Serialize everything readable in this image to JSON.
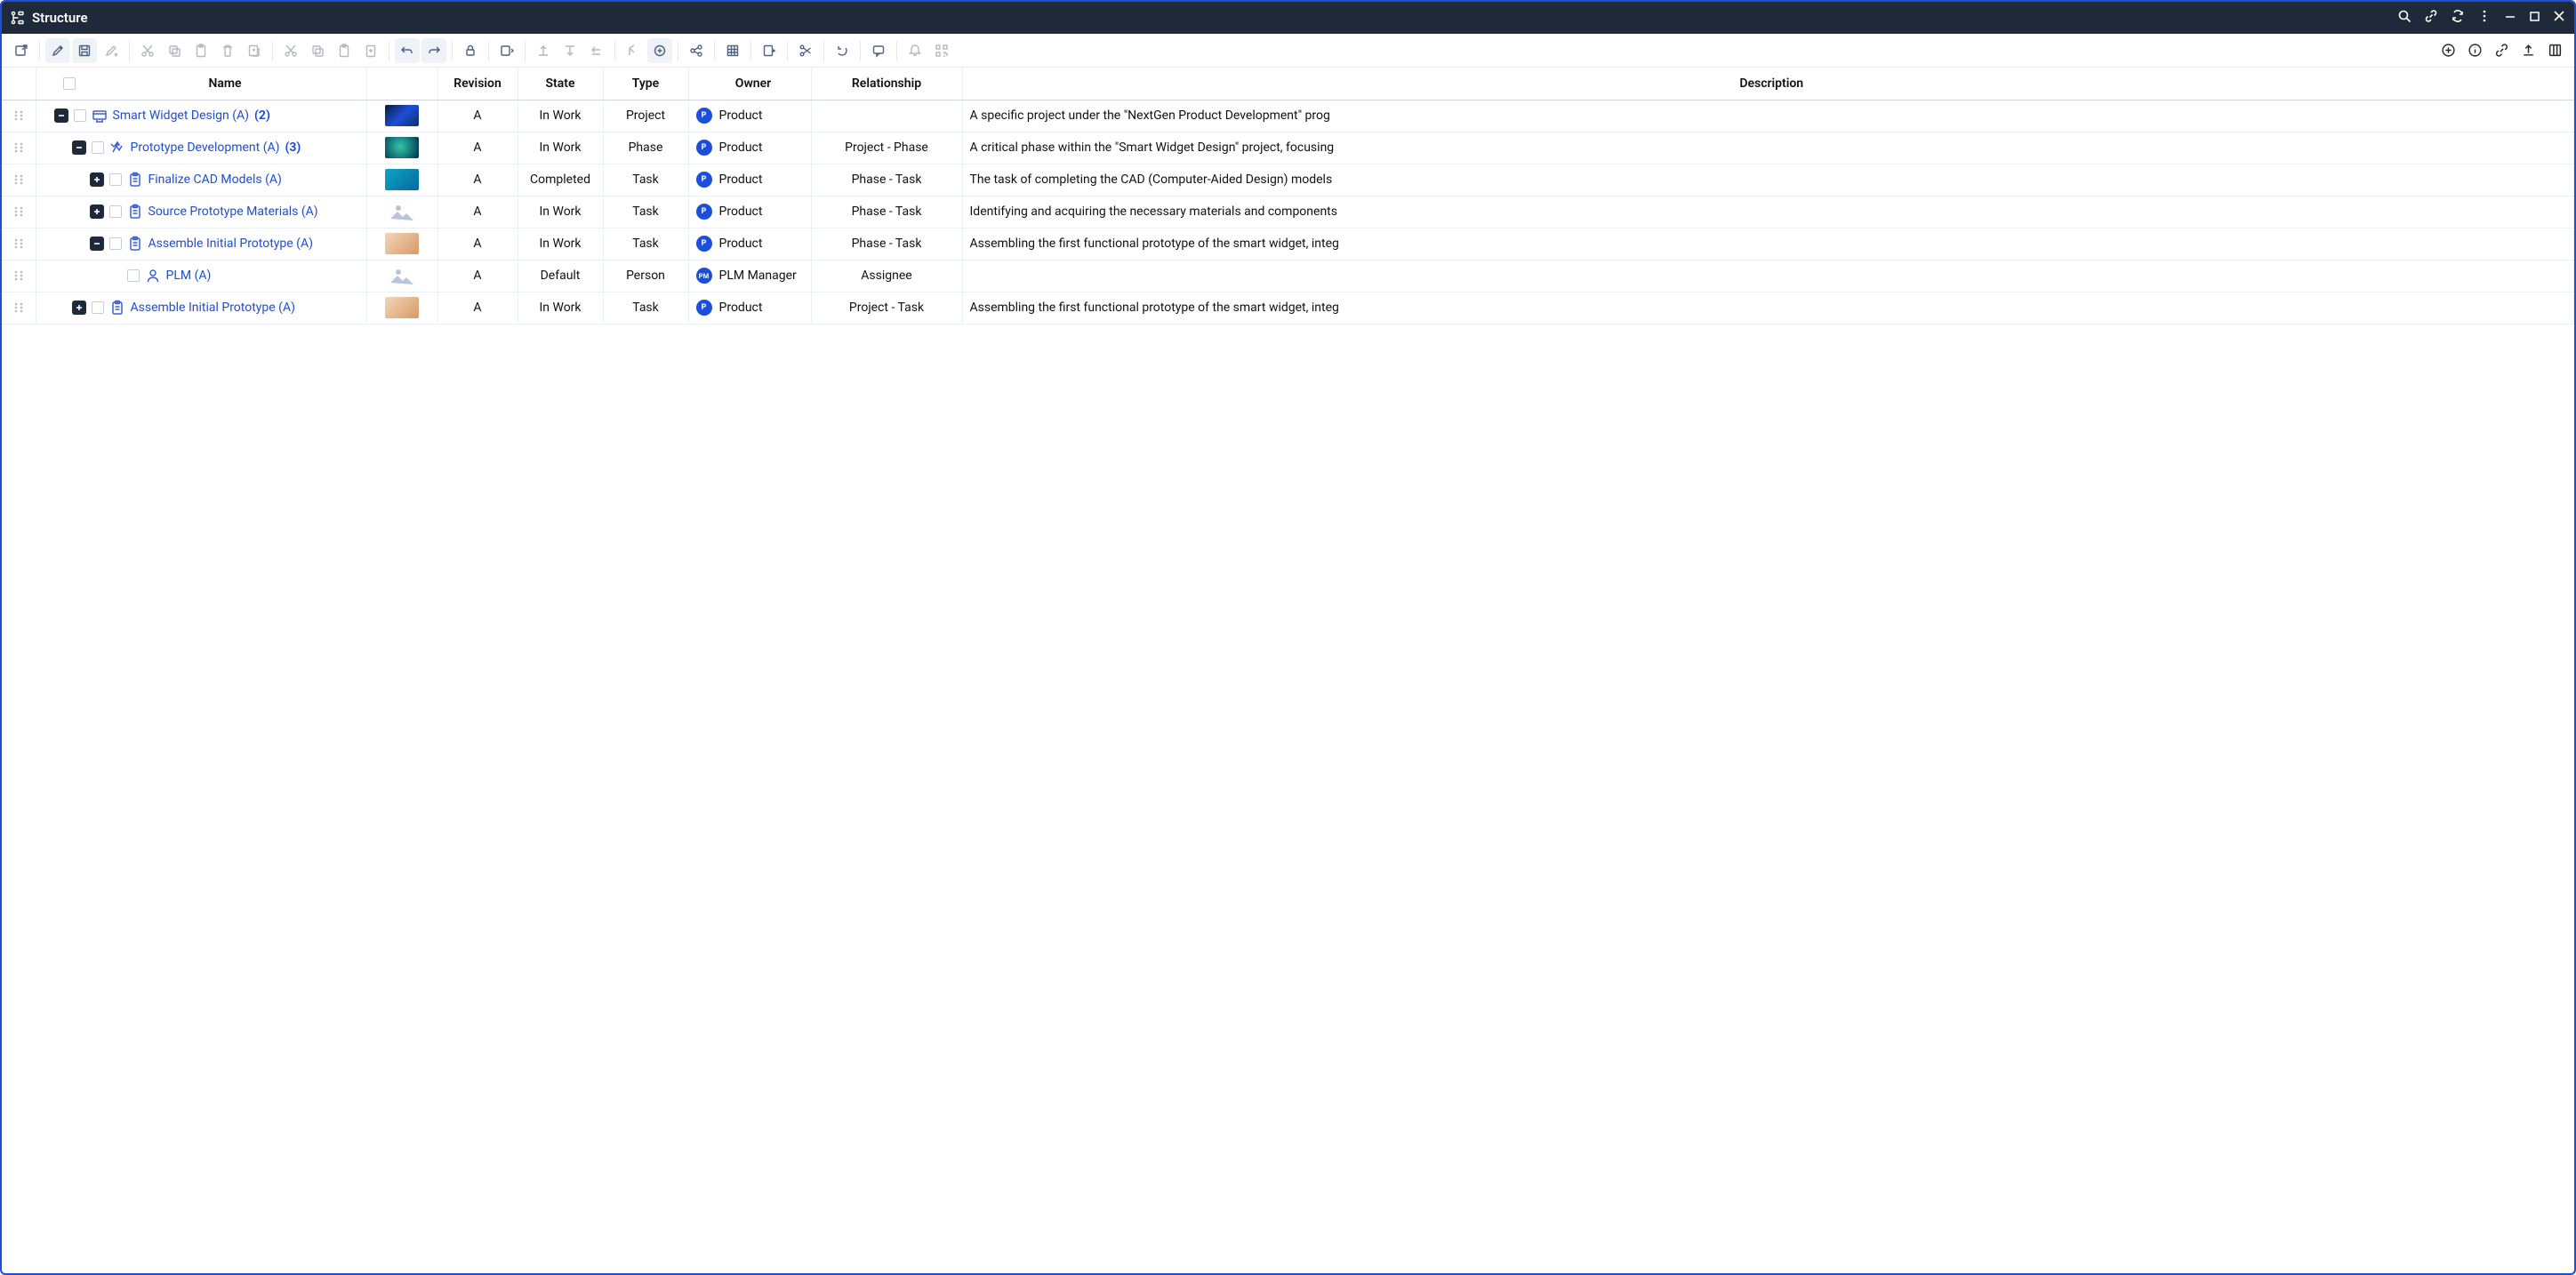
{
  "titlebar": {
    "title": "Structure"
  },
  "columns": {
    "name": "Name",
    "revision": "Revision",
    "state": "State",
    "type": "Type",
    "owner": "Owner",
    "relationship": "Relationship",
    "description": "Description"
  },
  "rows": [
    {
      "indent": 0,
      "expand": "open",
      "icon": "project",
      "name": "Smart Widget Design (A)",
      "count": "(2)",
      "thumb": "tech-blue",
      "revision": "A",
      "state": "In Work",
      "type": "Project",
      "ownerBadge": "P",
      "owner": "Product",
      "relationship": "",
      "description": "A specific project under the \"NextGen Product Development\" prog"
    },
    {
      "indent": 1,
      "expand": "open",
      "icon": "phase",
      "name": "Prototype Development (A)",
      "count": "(3)",
      "thumb": "globe",
      "revision": "A",
      "state": "In Work",
      "type": "Phase",
      "ownerBadge": "P",
      "owner": "Product",
      "relationship": "Project - Phase",
      "description": "A critical phase within the \"Smart Widget Design\" project, focusing"
    },
    {
      "indent": 2,
      "expand": "closed",
      "icon": "task",
      "name": "Finalize CAD Models (A)",
      "count": "",
      "thumb": "cad",
      "revision": "A",
      "state": "Completed",
      "type": "Task",
      "ownerBadge": "P",
      "owner": "Product",
      "relationship": "Phase - Task",
      "description": "The task of completing the CAD (Computer-Aided Design) models"
    },
    {
      "indent": 2,
      "expand": "closed",
      "icon": "task",
      "name": "Source Prototype Materials (A)",
      "count": "",
      "thumb": "placeholder",
      "revision": "A",
      "state": "In Work",
      "type": "Task",
      "ownerBadge": "P",
      "owner": "Product",
      "relationship": "Phase - Task",
      "description": "Identifying and acquiring the necessary materials and components"
    },
    {
      "indent": 2,
      "expand": "open",
      "icon": "task",
      "name": "Assemble Initial Prototype (A)",
      "count": "",
      "thumb": "assembly",
      "revision": "A",
      "state": "In Work",
      "type": "Task",
      "ownerBadge": "P",
      "owner": "Product",
      "relationship": "Phase - Task",
      "description": "Assembling the first functional prototype of the smart widget, integ"
    },
    {
      "indent": 3,
      "expand": "none",
      "icon": "person",
      "name": "PLM (A)",
      "count": "",
      "thumb": "placeholder",
      "revision": "A",
      "state": "Default",
      "type": "Person",
      "ownerBadge": "PM",
      "owner": "PLM Manager",
      "relationship": "Assignee",
      "description": ""
    },
    {
      "indent": 1,
      "expand": "closed",
      "icon": "task",
      "name": "Assemble Initial Prototype (A)",
      "count": "",
      "thumb": "assembly",
      "revision": "A",
      "state": "In Work",
      "type": "Task",
      "ownerBadge": "P",
      "owner": "Product",
      "relationship": "Project - Task",
      "description": "Assembling the first functional prototype of the smart widget, integ"
    }
  ]
}
